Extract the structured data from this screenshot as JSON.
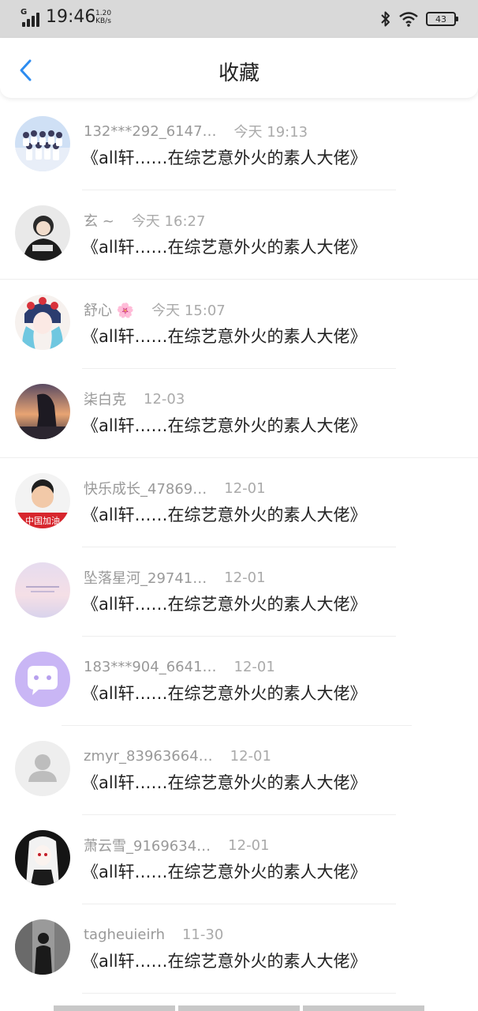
{
  "status_bar": {
    "network": "G",
    "time": "19:46",
    "speed_value": "1.20",
    "speed_unit": "KB/s",
    "battery": "43"
  },
  "header": {
    "title": "收藏"
  },
  "items": [
    {
      "name": "132***292_6147…",
      "time": "今天 19:13",
      "text": "《all轩……在综艺意外火的素人大佬》",
      "avatar": "group-photo"
    },
    {
      "name": "玄 ~",
      "time": "今天 16:27",
      "text": "《all轩……在综艺意外火的素人大佬》",
      "avatar": "person-dark"
    },
    {
      "name": "舒心 🌸",
      "time": "今天 15:07",
      "text": "《all轩……在综艺意外火的素人大佬》",
      "avatar": "opera-girl"
    },
    {
      "name": "柒白克",
      "time": "12-03",
      "text": "《all轩……在综艺意外火的素人大佬》",
      "avatar": "sunset-girl"
    },
    {
      "name": "快乐成长_47869…",
      "time": "12-01",
      "text": "《all轩……在综艺意外火的素人大佬》",
      "avatar": "child-photo"
    },
    {
      "name": "坠落星河_29741…",
      "time": "12-01",
      "text": "《all轩……在综艺意外火的素人大佬》",
      "avatar": "pastel-sky"
    },
    {
      "name": "183***904_6641…",
      "time": "12-01",
      "text": "《all轩……在综艺意外火的素人大佬》",
      "avatar": "chat-bubble"
    },
    {
      "name": "zmyr_83963664…",
      "time": "12-01",
      "text": "《all轩……在综艺意外火的素人大佬》",
      "avatar": "default-user"
    },
    {
      "name": "萧云雪_9169634…",
      "time": "12-01",
      "text": "《all轩……在综艺意外火的素人大佬》",
      "avatar": "anime-girl"
    },
    {
      "name": "tagheuieirh",
      "time": "11-30",
      "text": "《all轩……在综艺意外火的素人大佬》",
      "avatar": "man-bw"
    }
  ],
  "colors": {
    "accent": "#2d8cf0",
    "status_bar_bg": "#d9d9d9",
    "meta_text": "#999999",
    "content_text": "#222222",
    "chat_avatar_bg": "#c9b6f5"
  }
}
